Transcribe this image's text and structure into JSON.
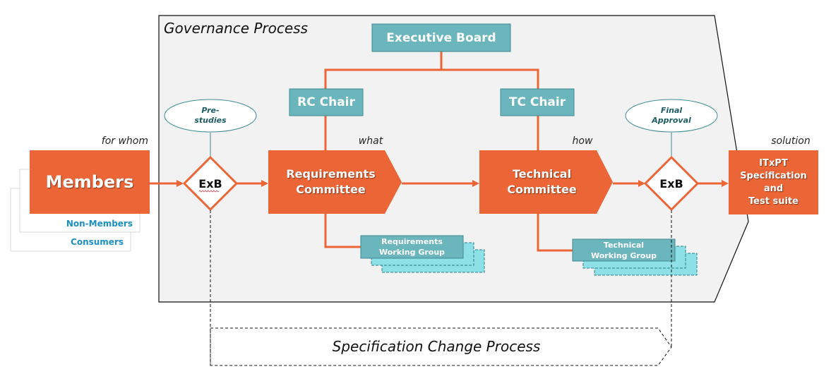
{
  "title": "Governance Process",
  "colors": {
    "orange": "#ec6536",
    "teal": "#6bb5bc",
    "teal_border": "#3f8a92",
    "light_cyan": "#8ce0e6",
    "panel_bg": "#f2f2f2",
    "blue_text": "#1b8fc4",
    "ellipse_text": "#1d5e63"
  },
  "stage_labels": {
    "for_whom": "for whom",
    "what": "what",
    "how": "how",
    "solution": "solution"
  },
  "audience": {
    "members": "Members",
    "non_members": "Non-Members",
    "consumers": "Consumers"
  },
  "executive_board": "Executive Board",
  "rc_chair": "RC Chair",
  "tc_chair": "TC Chair",
  "pre_studies": "Pre-\nstudies",
  "final_approval": "Final\nApproval",
  "gate_left": "ExB",
  "gate_right": "ExB",
  "requirements_committee": "Requirements\nCommittee",
  "technical_committee": "Technical\nCommittee",
  "requirements_working_group": "Requirements\nWorking Group",
  "technical_working_group": "Technical\nWorking Group",
  "solution_box": "ITxPT\nSpecification\nand\nTest suite",
  "specification_change_process": "Specification Change Process"
}
